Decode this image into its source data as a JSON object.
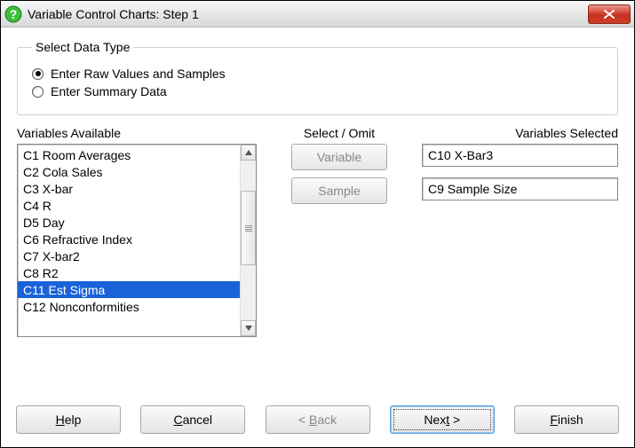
{
  "window": {
    "title": "Variable Control Charts: Step 1"
  },
  "group": {
    "legend": "Select Data Type",
    "options": [
      {
        "label": "Enter Raw Values and Samples",
        "selected": true
      },
      {
        "label": "Enter Summary Data",
        "selected": false
      }
    ]
  },
  "labels": {
    "available": "Variables Available",
    "selectOmit": "Select / Omit",
    "selected": "Variables Selected"
  },
  "available_items": [
    {
      "label": "C1 Room Averages",
      "selected": false
    },
    {
      "label": "C2 Cola Sales",
      "selected": false
    },
    {
      "label": "C3 X-bar",
      "selected": false
    },
    {
      "label": "C4 R",
      "selected": false
    },
    {
      "label": "D5 Day",
      "selected": false
    },
    {
      "label": "C6 Refractive Index",
      "selected": false
    },
    {
      "label": "C7 X-bar2",
      "selected": false
    },
    {
      "label": "C8 R2",
      "selected": false
    },
    {
      "label": "C11 Est Sigma",
      "selected": true
    },
    {
      "label": "C12 Nonconformities",
      "selected": false
    }
  ],
  "mid_buttons": {
    "variable": "Variable",
    "sample": "Sample"
  },
  "selected_values": {
    "variable": "C10 X-Bar3",
    "sample": "C9 Sample Size"
  },
  "footer": {
    "help": {
      "pre": "",
      "m": "H",
      "post": "elp"
    },
    "cancel": {
      "pre": "",
      "m": "C",
      "post": "ancel"
    },
    "back": {
      "pre": "< ",
      "m": "B",
      "post": "ack"
    },
    "next": {
      "pre": "Nex",
      "m": "t",
      "post": " >"
    },
    "finish": {
      "pre": "",
      "m": "F",
      "post": "inish"
    }
  }
}
